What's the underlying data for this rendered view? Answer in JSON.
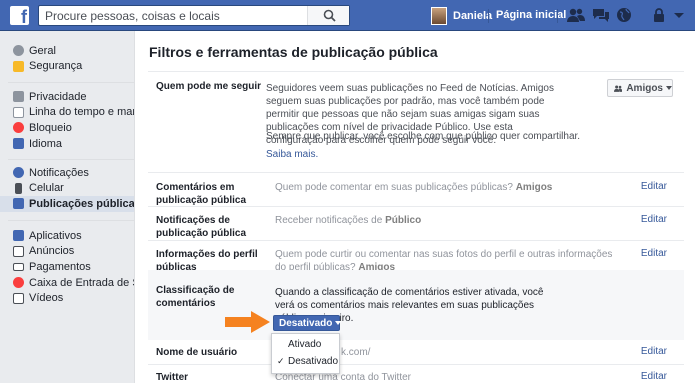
{
  "topbar": {
    "logo": "f",
    "search_placeholder": "Procure pessoas, coisas e locais",
    "user_name": "Daniela",
    "home_label": "Página inicial",
    "brand_color": "#4267b2"
  },
  "sidebar": {
    "groups": [
      [
        {
          "label": "Geral",
          "icon": "gear-icon",
          "color": "#8d949e"
        },
        {
          "label": "Segurança",
          "icon": "shield-icon",
          "color": "#f7b928"
        }
      ],
      [
        {
          "label": "Privacidade",
          "icon": "lock-icon",
          "color": "#8d949e"
        },
        {
          "label": "Linha do tempo e marc...",
          "icon": "timeline-icon",
          "color": "#8d949e"
        },
        {
          "label": "Bloqueio",
          "icon": "block-icon",
          "color": "#fa3e3e"
        },
        {
          "label": "Idioma",
          "icon": "language-icon",
          "color": "#4267b2"
        }
      ],
      [
        {
          "label": "Notificações",
          "icon": "globe-icon",
          "color": "#4267b2"
        },
        {
          "label": "Celular",
          "icon": "phone-icon",
          "color": "#4b4f56"
        },
        {
          "label": "Publicações públicas",
          "icon": "rss-icon",
          "color": "#4267b2",
          "active": true
        }
      ],
      [
        {
          "label": "Aplicativos",
          "icon": "apps-icon",
          "color": "#4267b2"
        },
        {
          "label": "Anúncios",
          "icon": "ads-icon",
          "color": "#4b4f56"
        },
        {
          "label": "Pagamentos",
          "icon": "card-icon",
          "color": "#4b4f56"
        },
        {
          "label": "Caixa de Entrada de Su...",
          "icon": "support-icon",
          "color": "#fa3e3e"
        },
        {
          "label": "Vídeos",
          "icon": "video-icon",
          "color": "#4b4f56"
        }
      ]
    ]
  },
  "main": {
    "title": "Filtros e ferramentas de publicação pública",
    "follow": {
      "label": "Quem pode me seguir",
      "description": "Seguidores veem suas publicações no Feed de Notícias. Amigos seguem suas publicações por padrão, mas você também pode permitir que pessoas que não sejam suas amigas sigam suas publicações com nível de privacidade Público. Use esta configuração para escolher quem pode seguir você.",
      "note": "Sempre que publicar, você escolhe com que público quer compartilhar.",
      "link": "Saiba mais.",
      "button": "Amigos"
    },
    "rows": [
      {
        "label": "Comentários em publicação pública",
        "text": "Quem pode comentar em suas publicações públicas?",
        "value": "Amigos",
        "edit": "Editar"
      },
      {
        "label": "Notificações de publicação pública",
        "text": "Receber notificações de",
        "value": "Público",
        "edit": "Editar"
      },
      {
        "label": "Informações do perfil públicas",
        "text": "Quem pode curtir ou comentar nas suas fotos do perfil e outras informações do perfil públicas?",
        "value": "Amigos",
        "edit": "Editar"
      }
    ],
    "ranking": {
      "label": "Classificação de comentários",
      "description": "Quando a classificação de comentários estiver ativada, você verá os comentários mais relevantes em suas publicações públicas primeiro.",
      "button": "Desativado",
      "options": [
        "Ativado",
        "Desativado"
      ],
      "selected": "Desativado"
    },
    "username": {
      "label": "Nome de usuário",
      "text": "k.com/",
      "edit": "Editar"
    },
    "twitter": {
      "label": "Twitter",
      "text": "Conectar uma conta do Twitter",
      "edit": "Editar"
    }
  }
}
